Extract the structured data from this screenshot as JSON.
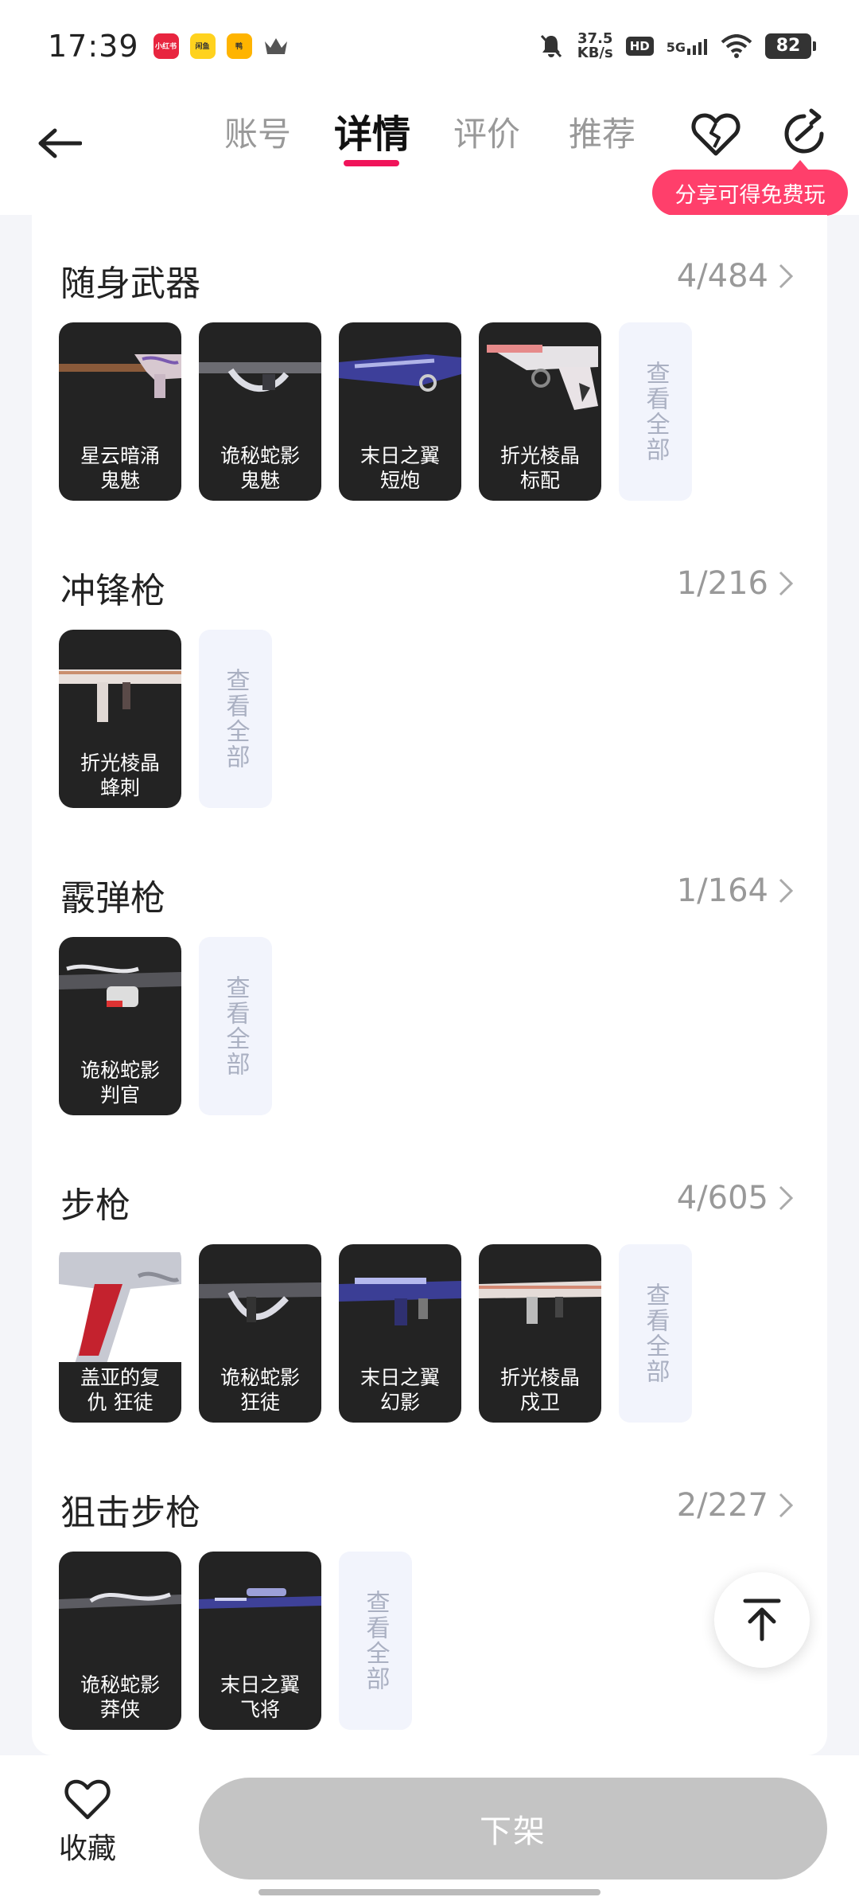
{
  "status_bar": {
    "time": "17:39",
    "app_chips": [
      "小红书",
      "闲鱼",
      "鸭"
    ],
    "net_speed_value": "37.5",
    "net_speed_unit": "KB/s",
    "hd": "HD",
    "network": "5G",
    "battery": "82"
  },
  "header": {
    "tabs": [
      {
        "label": "账号"
      },
      {
        "label": "详情"
      },
      {
        "label": "评价"
      },
      {
        "label": "推荐"
      }
    ],
    "active_tab": "详情",
    "share_tip": "分享可得免费玩"
  },
  "sections": [
    {
      "title": "随身武器",
      "count": "4/484",
      "items": [
        {
          "line1": "星云暗涌",
          "line2": "鬼魅"
        },
        {
          "line1": "诡秘蛇影",
          "line2": "鬼魅"
        },
        {
          "line1": "末日之翼",
          "line2": "短炮"
        },
        {
          "line1": "折光棱晶",
          "line2": "标配"
        }
      ],
      "view_all": "查看全部"
    },
    {
      "title": "冲锋枪",
      "count": "1/216",
      "items": [
        {
          "line1": "折光棱晶",
          "line2": "蜂刺"
        }
      ],
      "view_all": "查看全部"
    },
    {
      "title": "霰弹枪",
      "count": "1/164",
      "items": [
        {
          "line1": "诡秘蛇影",
          "line2": "判官"
        }
      ],
      "view_all": "查看全部"
    },
    {
      "title": "步枪",
      "count": "4/605",
      "items": [
        {
          "line1": "盖亚的复",
          "line2": "仇 狂徒"
        },
        {
          "line1": "诡秘蛇影",
          "line2": "狂徒"
        },
        {
          "line1": "末日之翼",
          "line2": "幻影"
        },
        {
          "line1": "折光棱晶",
          "line2": "戍卫"
        }
      ],
      "view_all": "查看全部"
    },
    {
      "title": "狙击步枪",
      "count": "2/227",
      "items": [
        {
          "line1": "诡秘蛇影",
          "line2": "莽侠"
        },
        {
          "line1": "末日之翼",
          "line2": "飞将"
        }
      ],
      "view_all": "查看全部"
    }
  ],
  "bottom_bar": {
    "favorite_label": "收藏",
    "delist_label": "下架"
  },
  "colors": {
    "accent": "#f0145a",
    "share_tip_bg": "#ff3f6b",
    "disabled_button": "#c4c4c4"
  },
  "icons": [
    "back-arrow-icon",
    "broken-heart-icon",
    "share-refresh-icon",
    "chevron-right-icon",
    "arrow-to-top-icon",
    "heart-outline-icon"
  ]
}
